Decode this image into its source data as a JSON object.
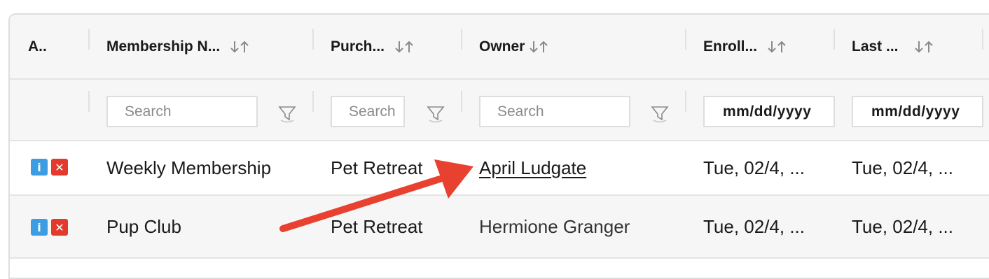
{
  "columns": [
    {
      "label": "A..",
      "sortable": false
    },
    {
      "label": "Membership N...",
      "sortable": true
    },
    {
      "label": "Purch...",
      "sortable": true
    },
    {
      "label": "Owner",
      "sortable": true
    },
    {
      "label": "Enroll...",
      "sortable": true
    },
    {
      "label": "Last ...",
      "sortable": true
    }
  ],
  "filters": {
    "membership_placeholder": "Search",
    "purchase_placeholder": "Search",
    "owner_placeholder": "Search",
    "enroll_date": "mm/dd/yyyy",
    "last_date": "mm/dd/yyyy"
  },
  "rows": [
    {
      "membership": "Weekly Membership",
      "purchase": "Pet Retreat",
      "owner": "April Ludgate",
      "owner_is_link": true,
      "enroll": "Tue, 02/4, ...",
      "last": "Tue, 02/4, ..."
    },
    {
      "membership": "Pup Club",
      "purchase": "Pet Retreat",
      "owner": "Hermione Granger",
      "owner_is_link": false,
      "enroll": "Tue, 02/4, ...",
      "last": "Tue, 02/4, ..."
    }
  ],
  "icons": {
    "sort": "sort-arrows-icon",
    "filter": "funnel-icon",
    "info": "info-icon",
    "delete": "close-icon"
  },
  "colors": {
    "header_bg": "#f5f6f5",
    "info_blue": "#3d9de3",
    "delete_red": "#e23b2e",
    "annotation_arrow": "#e8412f"
  }
}
